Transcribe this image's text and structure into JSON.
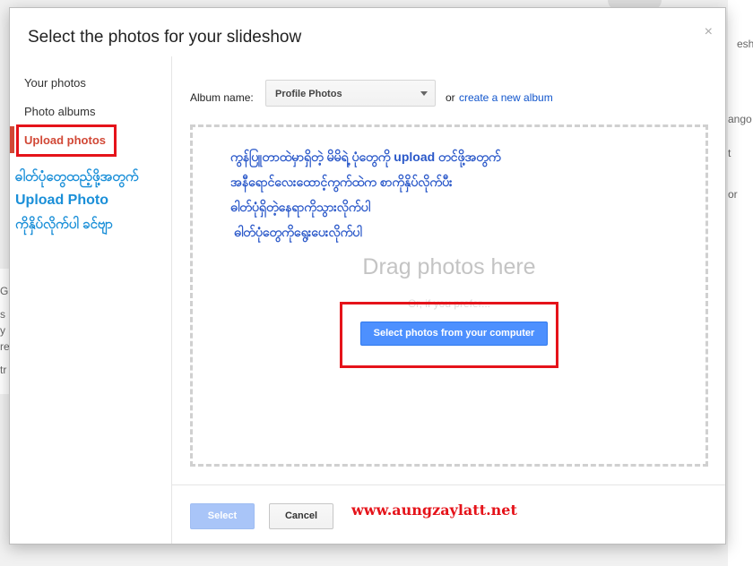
{
  "background": {
    "right_snippets": [
      "eshow",
      "ango",
      "t",
      "or"
    ],
    "left_snippets": [
      "G",
      "s i",
      "y",
      "re",
      "tr"
    ]
  },
  "dialog": {
    "title": "Select the photos for your slideshow",
    "close_glyph": "×"
  },
  "sidebar": {
    "items": [
      {
        "label": "Your photos"
      },
      {
        "label": "Photo albums"
      },
      {
        "label": "Upload photos",
        "active": true
      }
    ]
  },
  "annotations": {
    "left": [
      "ဓါတ်ပုံတွေထည့်ဖို့အတွက်",
      "Upload Photo",
      "ကိုနှိပ်လိုက်ပါ ခင်ဗျာ"
    ],
    "main": [
      "ကွန်ပြူတာထဲမှာရှိတဲ့ မိမိရဲ့ ပုံတွေကို upload တင်ဖို့အတွက်",
      "အနီရောင်လေးထောင့်ကွက်ထဲက စာကိုနှိပ်လိုက်ပီး",
      "ဓါတ်ပုံရှိတဲ့နေရာကိုသွားလိုက်ပါ",
      "ဓါတ်ပုံတွေကိုရွေးပေးလိုက်ပါ"
    ],
    "watermark": "www.aungzaylatt.net"
  },
  "album": {
    "label": "Album name:",
    "selected": "Profile Photos",
    "or_text": "or",
    "create_link": "create a new album"
  },
  "dropzone": {
    "drag_text": "Drag photos here",
    "or_prefer": "Or, if you prefer...",
    "button_label": "Select photos from your computer"
  },
  "footer": {
    "select_label": "Select",
    "cancel_label": "Cancel"
  },
  "colors": {
    "accent_red": "#d14836",
    "annotation_red": "#e5131a",
    "primary_blue": "#4d90fe",
    "link_blue": "#1155cc"
  }
}
